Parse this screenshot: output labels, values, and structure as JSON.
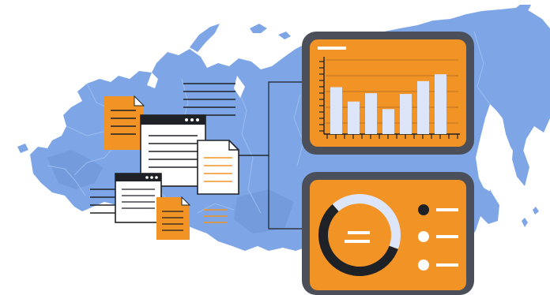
{
  "colors": {
    "background": "#ffffff",
    "map_fill": "#7ea6e6",
    "map_shadow": "#6b93d6",
    "map_border": "#9cbcee",
    "accent_orange": "#f29325",
    "panel_frame": "#4a4f5a",
    "bar_fill": "#dde6f8",
    "dark": "#1e2126",
    "light": "#ffffff",
    "line": "#1e2126"
  },
  "icons": {
    "map": "russia-map",
    "bar_chart": "bar-chart-panel-icon",
    "donut_chart": "donut-chart-panel-icon",
    "windows": "browser-window-icon",
    "documents": "document-icon"
  },
  "chart_data": [
    {
      "type": "bar",
      "categories": [],
      "values": [
        0.62,
        0.43,
        0.54,
        0.33,
        0.53,
        0.7,
        0.79
      ],
      "title": "",
      "xlabel": "",
      "ylabel": ""
    },
    {
      "type": "pie",
      "series": [
        {
          "values": [
            0.58,
            0.42
          ]
        }
      ],
      "title": ""
    }
  ],
  "legend": {
    "marker_colors": [
      "#1e2126",
      "#ffffff",
      "#ffffff"
    ]
  }
}
